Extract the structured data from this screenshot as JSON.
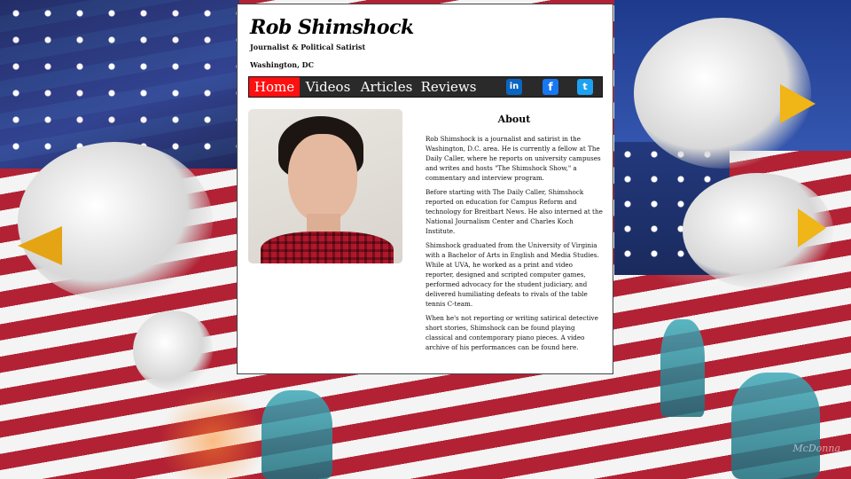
{
  "site": {
    "title": "Rob Shimshock",
    "subtitle": "Journalist & Political Satirist",
    "location": "Washington, DC"
  },
  "nav": {
    "items": [
      "Home",
      "Videos",
      "Articles",
      "Reviews"
    ],
    "active": "Home"
  },
  "social": [
    {
      "name": "linkedin-icon",
      "glyph": "in"
    },
    {
      "name": "facebook-icon",
      "glyph": "f"
    },
    {
      "name": "twitter-icon",
      "glyph": "t"
    }
  ],
  "about": {
    "heading": "About",
    "paragraphs": [
      "Rob Shimshock is a journalist and satirist in the Washington, D.C. area. He is currently a fellow at The Daily Caller, where he reports on university campuses and writes and hosts \"The Shimshock Show,\" a commentary and interview program.",
      "Before starting with The Daily Caller, Shimshock reported on education for Campus Reform and technology for Breitbart News. He also interned at the National Journalism Center and Charles Koch Institute.",
      "Shimshock graduated from the University of Virginia with a Bachelor of Arts in English and Media Studies. While at UVA, he worked as a print and video reporter, designed and scripted computer games, performed advocacy for the student judiciary, and delivered humiliating defeats to rivals of the table tennis C-team.",
      "When he's not reporting or writing satirical detective short stories, Shimshock can be found playing classical and contemporary piano pieces. A video archive of his performances can be found here."
    ]
  },
  "background": {
    "signature": "McDonna"
  },
  "colors": {
    "nav_active": "#ff1010",
    "nav_bg": "#2a2a2a",
    "linkedin": "#0a66c2",
    "facebook": "#1877f2",
    "twitter": "#1da1f2"
  }
}
